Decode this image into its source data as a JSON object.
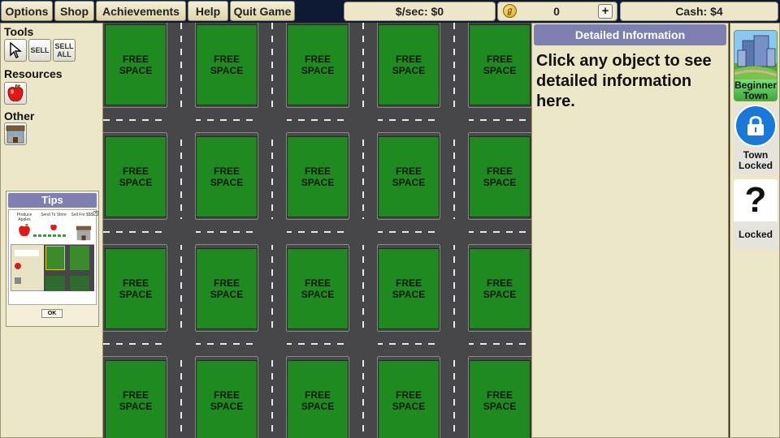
{
  "menu": {
    "options": "Options",
    "shop": "Shop",
    "achievements": "Achievements",
    "help": "Help",
    "quit": "Quit Game"
  },
  "stats": {
    "per_sec": "$/sec: $0",
    "coins": "0",
    "plus": "+",
    "cash": "Cash: $4"
  },
  "left_panel": {
    "tools_title": "Tools",
    "tools": {
      "cursor_icon": "arrow-cursor-icon",
      "sell": "SELL",
      "sell_all_line1": "SELL",
      "sell_all_line2": "ALL"
    },
    "resources_title": "Resources",
    "resources_icon": "apple-icon",
    "other_title": "Other",
    "other_icon": "store-building-icon",
    "tips": {
      "title": "Tips",
      "labels": [
        "Produce Apples",
        "Send To Store",
        "Sell For $$$"
      ],
      "ok": "OK"
    }
  },
  "map": {
    "lot_label": "FREE SPACE",
    "rows": 4,
    "cols": 5,
    "lot_color": "#1f8a1f",
    "road_color": "#47474a"
  },
  "info": {
    "header": "Detailed Information",
    "body": "Click any object to see detailed information here."
  },
  "towns": [
    {
      "name": "Beginner Town",
      "line1": "Beginner",
      "line2": "Town",
      "icon": "city-skyline-icon"
    },
    {
      "name": "Town Locked",
      "line1": "Town",
      "line2": "Locked",
      "icon": "padlock-icon"
    },
    {
      "name": "Locked",
      "line1": "Locked",
      "line2": "",
      "icon": "question-mark-icon"
    }
  ]
}
